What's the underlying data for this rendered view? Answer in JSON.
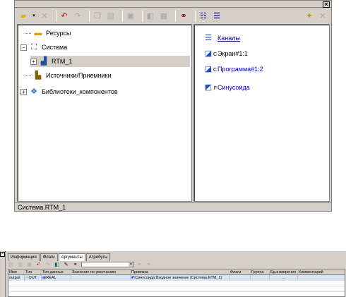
{
  "tree": {
    "items": [
      {
        "label": "Ресурсы",
        "icon": "folder-resources-icon"
      },
      {
        "label": "Система",
        "icon": "system-network-icon"
      },
      {
        "label": "RTM_1",
        "icon": "rtm-device-icon"
      },
      {
        "label": "Источники/Приемники",
        "icon": "sources-receivers-icon"
      },
      {
        "label": "Библиотеки_компонентов",
        "icon": "component-library-icon"
      }
    ]
  },
  "list": {
    "items": [
      {
        "label": "Каналы",
        "badge": "",
        "icon": "channels-icon"
      },
      {
        "label": "Экран#1:1",
        "badge": "C",
        "icon": "screen-icon"
      },
      {
        "label": "Программа#1:2",
        "badge": "C",
        "icon": "program-icon"
      },
      {
        "label": "Синусоида",
        "badge": "F",
        "icon": "sinusoid-icon"
      }
    ]
  },
  "status": {
    "path": "Система.RTM_1"
  },
  "bottom": {
    "tabs": [
      "Информация",
      "Флаги",
      "Аргументы",
      "Атрибуты"
    ],
    "active_tab": "Аргументы",
    "columns": [
      "Имя",
      "Тип",
      "Тип данных",
      "Значение по умолчанию",
      "Привязка",
      "Флаги",
      "Группа",
      "Ед.измерения",
      "Комментарий"
    ],
    "row": {
      "name": "output",
      "type": "OUT",
      "data_type": "REAL",
      "default": "",
      "binding": "Синусоида:Входное значение (Система.RTM_1)",
      "flags": "",
      "group": "",
      "unit": "...",
      "comment": ""
    }
  },
  "colors": {
    "panel": "#d4d0c8",
    "link": "#0000cc",
    "highlight_row": "#d8e4f4"
  }
}
